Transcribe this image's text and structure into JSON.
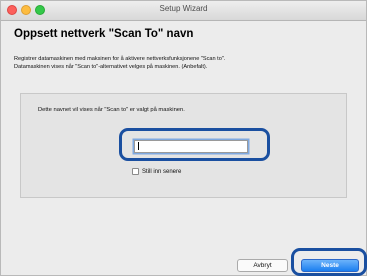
{
  "window": {
    "title": "Setup Wizard"
  },
  "page": {
    "heading": "Oppsett nettverk \"Scan To\" navn",
    "description_line1": "Registrer datamaskinen med maksinen for å aktivere nettverksfunksjonene \"Scan to\".",
    "description_line2": "Datamaskinen vises når \"Scan to\"-alternativet velges på maskinen. (Anbefalt)."
  },
  "form": {
    "prompt": "Dette navnet vil vises når \"Scan to\" er valgt på maskinen.",
    "name_value": "",
    "later_checkbox_label": "Still inn senere",
    "later_checked": false
  },
  "footer": {
    "cancel_label": "Avbryt",
    "next_label": "Neste"
  },
  "colors": {
    "highlight": "#1a4fa0",
    "primary_button": "#1b7ff0"
  }
}
